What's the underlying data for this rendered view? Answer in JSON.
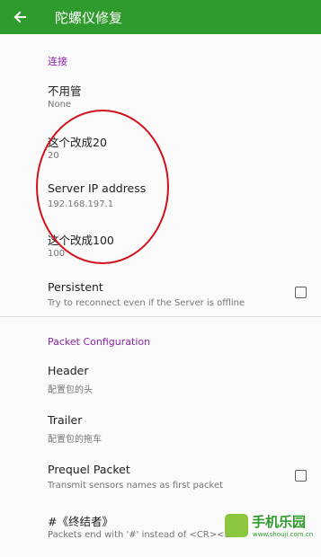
{
  "appbar": {
    "back_icon": "arrow-left-icon",
    "title": "陀螺仪修复",
    "background": "#2f9b2c"
  },
  "sections": {
    "connection": {
      "header": "连接",
      "items": [
        {
          "title": "不用管",
          "summary": "None"
        },
        {
          "title": "这个改成20",
          "summary": "20"
        },
        {
          "title": "Server IP address",
          "summary": "192.168.197.1"
        },
        {
          "title": "这个改成100",
          "summary": "100"
        },
        {
          "title": "Persistent",
          "summary": "Try to reconnect even if the Server is offline",
          "checked": false
        }
      ]
    },
    "packet": {
      "header": "Packet Configuration",
      "items": [
        {
          "title": "Header",
          "summary": "配置包的头"
        },
        {
          "title": "Trailer",
          "summary": "配置包的拖车"
        },
        {
          "title": "Prequel Packet",
          "summary": "Transmit sensors names as first packet",
          "checked": false
        },
        {
          "title": "#《终结者》",
          "summary": "Packets end with '#' instead of <CR><LF>"
        }
      ]
    }
  },
  "colors": {
    "accent": "#8e24aa",
    "annotation": "#d0121a"
  },
  "watermark": {
    "text": "手机乐园",
    "url": "www.shouji.com.cn"
  }
}
